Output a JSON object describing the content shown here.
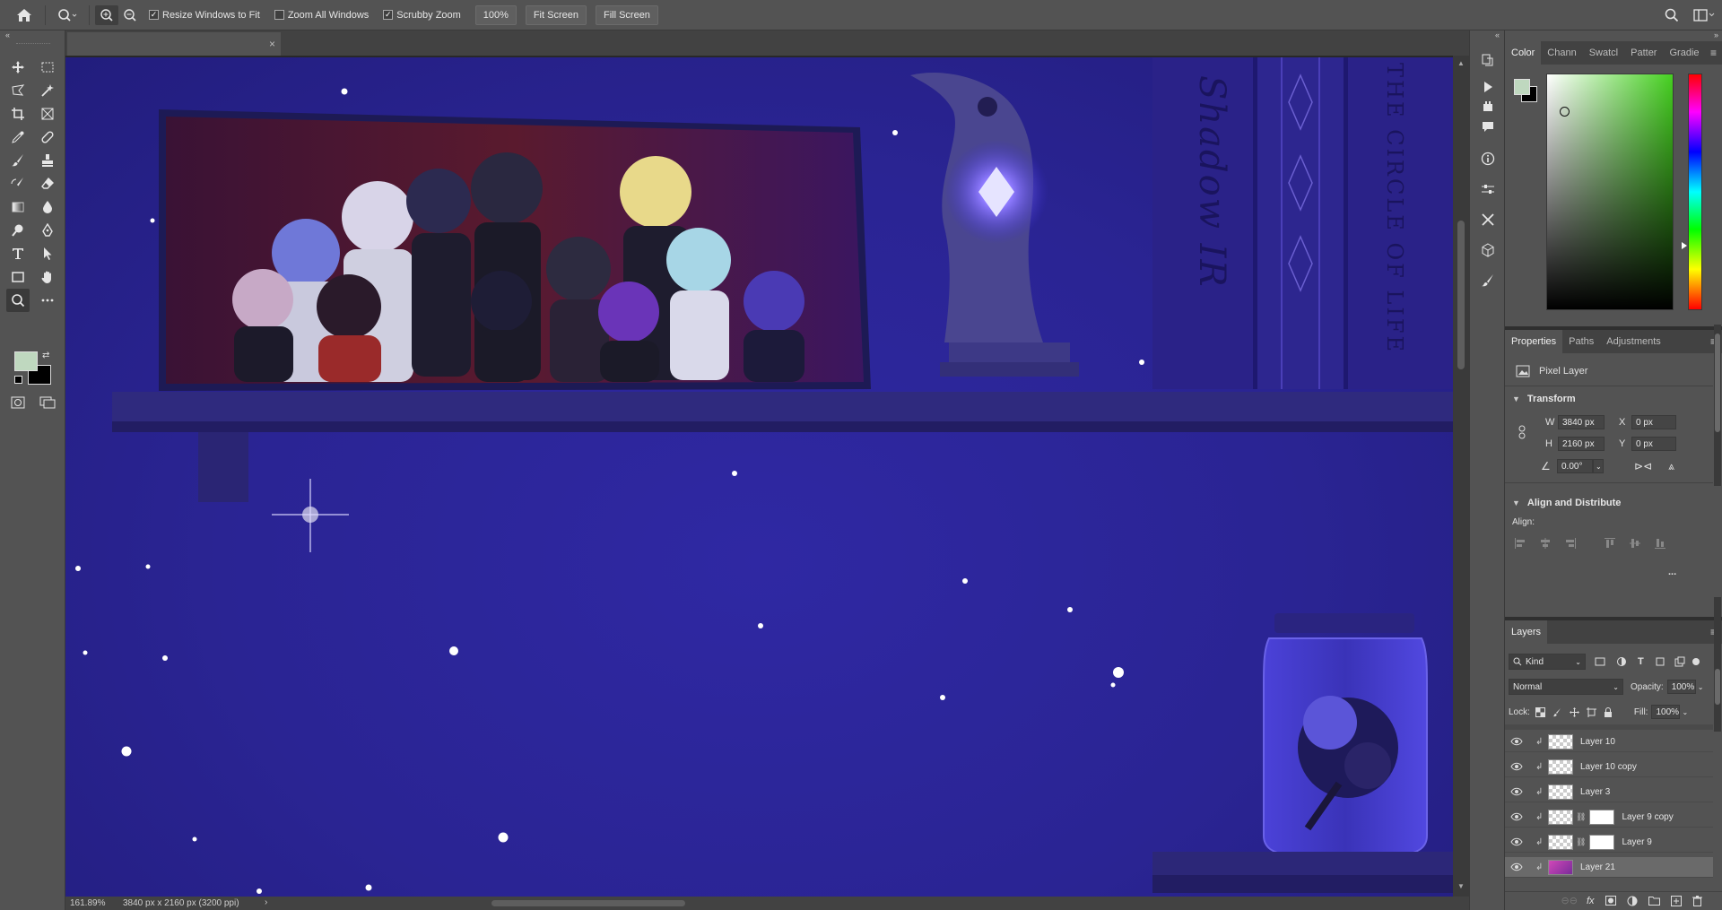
{
  "options_bar": {
    "resize_windows_label": "Resize Windows to Fit",
    "resize_windows_checked": true,
    "zoom_all_label": "Zoom All Windows",
    "zoom_all_checked": false,
    "scrubby_label": "Scrubby Zoom",
    "scrubby_checked": true,
    "zoom_value": "100%",
    "fit_screen_label": "Fit Screen",
    "fill_screen_label": "Fill Screen"
  },
  "status": {
    "zoom": "161.89%",
    "doc_info": "3840 px x 2160 px (3200 ppi)",
    "arrow": "›"
  },
  "color_panel": {
    "tabs": [
      "Color",
      "Chann",
      "Swatcl",
      "Patter",
      "Gradie"
    ],
    "foreground": "#bfd8bf",
    "background": "#000000"
  },
  "properties_panel": {
    "tabs": [
      "Properties",
      "Paths",
      "Adjustments"
    ],
    "layer_type": "Pixel Layer",
    "transform_title": "Transform",
    "w_label": "W",
    "w_value": "3840 px",
    "h_label": "H",
    "h_value": "2160 px",
    "x_label": "X",
    "x_value": "0 px",
    "y_label": "Y",
    "y_value": "0 px",
    "angle_value": "0.00°",
    "align_title": "Align and Distribute",
    "align_label": "Align:",
    "more": "..."
  },
  "layers_panel": {
    "title": "Layers",
    "filter_kind": "Kind",
    "blend_mode": "Normal",
    "opacity_label": "Opacity:",
    "opacity_value": "100%",
    "lock_label": "Lock:",
    "fill_label": "Fill:",
    "fill_value": "100%",
    "layers": [
      {
        "name": "Layer 10",
        "mask": false,
        "selected": false
      },
      {
        "name": "Layer 10 copy",
        "mask": false,
        "selected": false
      },
      {
        "name": "Layer 3",
        "mask": false,
        "selected": false
      },
      {
        "name": "Layer 9 copy",
        "mask": true,
        "selected": false
      },
      {
        "name": "Layer 9",
        "mask": true,
        "selected": false
      },
      {
        "name": "Layer 21",
        "mask": false,
        "selected": true
      }
    ]
  },
  "canvas": {
    "book_spine_1": "Shadow IR",
    "book_spine_2": "THE CIRCLE OF LIFE"
  }
}
